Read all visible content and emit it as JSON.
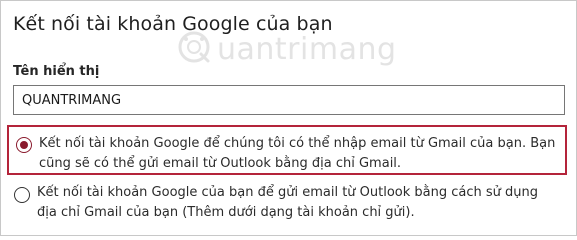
{
  "dialog": {
    "title": "Kết nối tài khoản Google của bạn"
  },
  "watermark": {
    "text": "uantrimang",
    "logo_icon": "quantrimang-logo-icon"
  },
  "display_name": {
    "label": "Tên hiển thị",
    "value": "QUANTRIMANG"
  },
  "options": [
    {
      "label": "Kết nối tài khoản Google để chúng tôi có thể nhập email từ Gmail của bạn. Bạn cũng sẽ có thể gửi email từ Outlook bằng địa chỉ Gmail.",
      "selected": true
    },
    {
      "label": "Kết nối tài khoản Google của bạn để gửi email từ Outlook bằng cách sử dụng địa chỉ Gmail của bạn (Thêm dưới dạng tài khoản chỉ gửi).",
      "selected": false
    }
  ],
  "colors": {
    "accent": "#8a1b2e",
    "selection_border": "#b4243a"
  }
}
